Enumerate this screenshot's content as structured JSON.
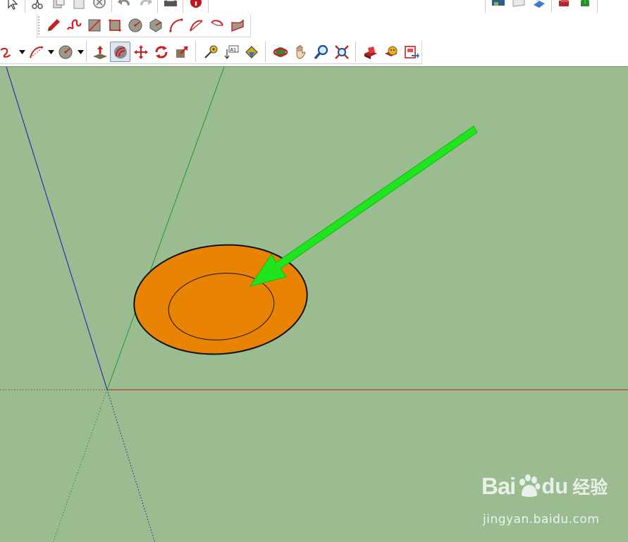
{
  "toolbar": {
    "row0_left": [
      "select-icon",
      "eraser-icon",
      "copy-icon",
      "paste-icon",
      "delete-icon",
      "undo-icon",
      "redo-icon",
      "print-icon",
      "model-info-icon"
    ],
    "row0_right": [
      "layers-icon",
      "page-icon",
      "paint-icon",
      "upload-icon",
      "component-icon"
    ],
    "row1": [
      "pencil-icon",
      "freehand-icon",
      "rectangle-icon",
      "rotated-rectangle-icon",
      "circle-icon",
      "polygon-icon",
      "arc-icon",
      "two-point-arc-icon",
      "three-point-arc-icon",
      "pie-icon"
    ],
    "row2": [
      "freehand-icon",
      "arc-icon",
      "circle-icon",
      "push-pull-icon",
      "offset-icon",
      "move-icon",
      "rotate-icon",
      "scale-icon",
      "tape-measure-icon",
      "text-icon",
      "paint-bucket-icon",
      "orbit-icon",
      "pan-icon",
      "zoom-icon",
      "zoom-extents-icon",
      "warehouse-icon",
      "extension-warehouse-icon",
      "send-to-layout-icon"
    ],
    "text_label": "A1",
    "active_tool": "offset-icon"
  },
  "colors": {
    "viewport_bg": "#9bbc90",
    "face_fill": "#e98303",
    "edge": "#111111",
    "arrow": "#1ee51e",
    "axis_red": "#b42020",
    "axis_green": "#1f9a1f",
    "axis_blue": "#1818b0",
    "accent_red": "#d32a2a"
  },
  "watermark": {
    "brand_bai": "Bai",
    "brand_du": "du",
    "brand_jingyan": "经验",
    "site": "jingyan.baidu.com"
  }
}
